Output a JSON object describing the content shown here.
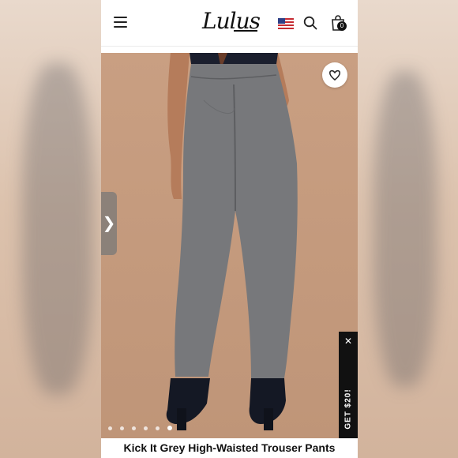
{
  "header": {
    "menu_icon": "hamburger-menu-icon",
    "logo_text": "Lulus",
    "flag_icon": "us-flag-icon",
    "search_icon": "search-icon",
    "bag_icon": "shopping-bag-icon",
    "bag_count": "0"
  },
  "gallery": {
    "wishlist_icon": "heart-icon",
    "next_icon": "chevron-right-icon",
    "next_glyph": "❯",
    "dot_count": 6,
    "active_dot": 6
  },
  "promo": {
    "label": "GET $20!",
    "close_glyph": "✕"
  },
  "product": {
    "title": "Kick It Grey High-Waisted Trouser Pants"
  },
  "colors": {
    "background_beige": "#c99f82",
    "pants_grey": "#77787b",
    "promo_black": "#111111"
  }
}
